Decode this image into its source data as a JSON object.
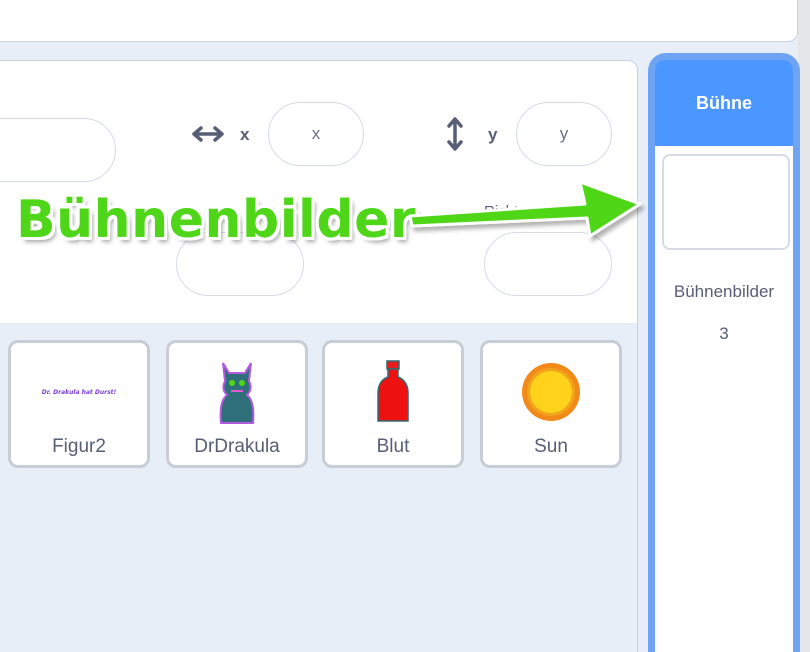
{
  "info_panel": {
    "x_label": "x",
    "x_placeholder": "x",
    "y_label": "y",
    "y_placeholder": "y",
    "hidden_partial_label": "Richtung"
  },
  "sprites": [
    {
      "name": "Figur2",
      "thumb_text": "Dr. Drakula hat Durst!"
    },
    {
      "name": "DrDrakula"
    },
    {
      "name": "Blut"
    },
    {
      "name": "Sun"
    }
  ],
  "stage": {
    "header": "Bühne",
    "backdrops_label": "Bühnenbilder",
    "backdrops_count": "3"
  },
  "annotation": {
    "text": "Bühnenbilder",
    "color": "#4fd619"
  },
  "colors": {
    "accent": "#4c97ff",
    "stage_border": "#6fa3f4"
  }
}
